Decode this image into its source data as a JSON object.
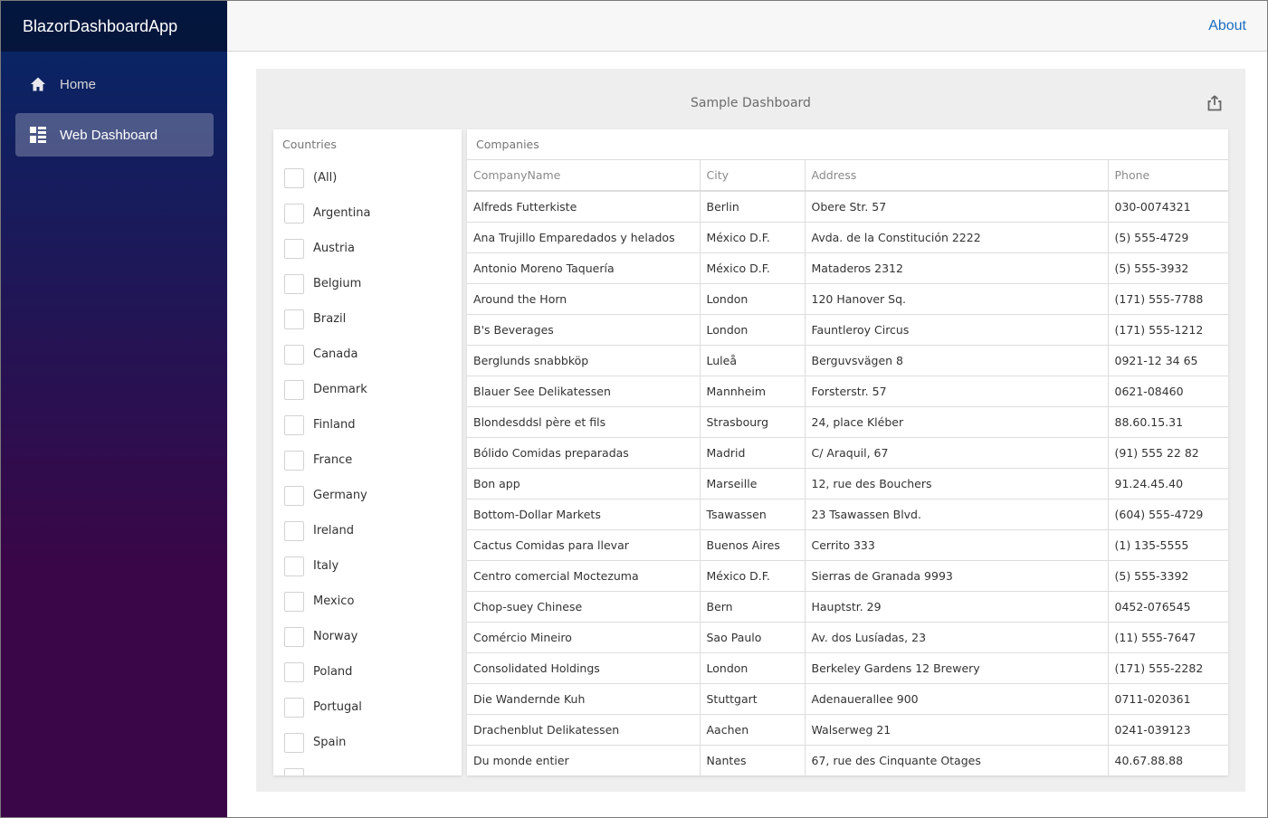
{
  "app": {
    "brand": "BlazorDashboardApp",
    "about_link": "About"
  },
  "sidebar": {
    "items": [
      {
        "label": "Home",
        "icon": "home-icon",
        "active": false
      },
      {
        "label": "Web Dashboard",
        "icon": "dashboard-icon",
        "active": true
      }
    ]
  },
  "dashboard": {
    "title": "Sample Dashboard",
    "export_icon": "export-icon",
    "countries": {
      "caption": "Countries",
      "items": [
        "(All)",
        "Argentina",
        "Austria",
        "Belgium",
        "Brazil",
        "Canada",
        "Denmark",
        "Finland",
        "France",
        "Germany",
        "Ireland",
        "Italy",
        "Mexico",
        "Norway",
        "Poland",
        "Portugal",
        "Spain",
        ""
      ]
    },
    "companies": {
      "caption": "Companies",
      "columns": [
        "CompanyName",
        "City",
        "Address",
        "Phone"
      ],
      "rows": [
        [
          "Alfreds Futterkiste",
          "Berlin",
          "Obere Str. 57",
          "030-0074321"
        ],
        [
          "Ana Trujillo Emparedados y helados",
          "México D.F.",
          "Avda. de la Constitución 2222",
          "(5) 555-4729"
        ],
        [
          "Antonio Moreno Taquería",
          "México D.F.",
          "Mataderos 2312",
          "(5) 555-3932"
        ],
        [
          "Around the Horn",
          "London",
          "120 Hanover Sq.",
          "(171) 555-7788"
        ],
        [
          "B's Beverages",
          "London",
          "Fauntleroy Circus",
          "(171) 555-1212"
        ],
        [
          "Berglunds snabbköp",
          "Luleå",
          "Berguvsvägen 8",
          "0921-12 34 65"
        ],
        [
          "Blauer See Delikatessen",
          "Mannheim",
          "Forsterstr. 57",
          "0621-08460"
        ],
        [
          "Blondesddsl père et fils",
          "Strasbourg",
          "24, place Kléber",
          "88.60.15.31"
        ],
        [
          "Bólido Comidas preparadas",
          "Madrid",
          "C/ Araquil, 67",
          "(91) 555 22 82"
        ],
        [
          "Bon app",
          "Marseille",
          "12, rue des Bouchers",
          "91.24.45.40"
        ],
        [
          "Bottom-Dollar Markets",
          "Tsawassen",
          "23 Tsawassen Blvd.",
          "(604) 555-4729"
        ],
        [
          "Cactus Comidas para llevar",
          "Buenos Aires",
          "Cerrito 333",
          "(1) 135-5555"
        ],
        [
          "Centro comercial Moctezuma",
          "México D.F.",
          "Sierras de Granada 9993",
          "(5) 555-3392"
        ],
        [
          "Chop-suey Chinese",
          "Bern",
          "Hauptstr. 29",
          "0452-076545"
        ],
        [
          "Comércio Mineiro",
          "Sao Paulo",
          "Av. dos Lusíadas, 23",
          "(11) 555-7647"
        ],
        [
          "Consolidated Holdings",
          "London",
          "Berkeley Gardens 12 Brewery",
          "(171) 555-2282"
        ],
        [
          "Die Wandernde Kuh",
          "Stuttgart",
          "Adenauerallee 900",
          "0711-020361"
        ],
        [
          "Drachenblut Delikatessen",
          "Aachen",
          "Walserweg 21",
          "0241-039123"
        ],
        [
          "Du monde entier",
          "Nantes",
          "67, rue des Cinquante Otages",
          "40.67.88.88"
        ]
      ]
    }
  },
  "colors": {
    "sidebar_top": "#052767",
    "sidebar_bottom": "#3a0647",
    "link": "#1b6ec2",
    "dashboard_bg": "#eeeeee"
  }
}
